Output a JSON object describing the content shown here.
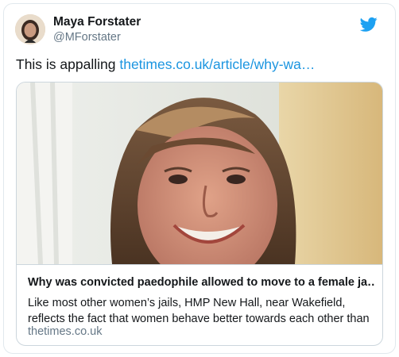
{
  "tweet": {
    "author_name": "Maya Forstater",
    "author_handle": "@MForstater",
    "text_prefix": "This is appalling ",
    "link_text": "thetimes.co.uk/article/why-wa…"
  },
  "card": {
    "title": "Why was convicted paedophile allowed to move to a female ja…",
    "description": "Like most other women’s jails, HMP New Hall, near Wakefield, reflects the fact that women behave better towards each other than",
    "domain": "thetimes.co.uk"
  },
  "colors": {
    "brand_blue": "#1da1f2",
    "link_blue": "#1b95e0",
    "text": "#14171a",
    "secondary_text": "#657786",
    "border": "#ccd6dd"
  },
  "icons": {
    "logo": "twitter-bird-icon"
  }
}
